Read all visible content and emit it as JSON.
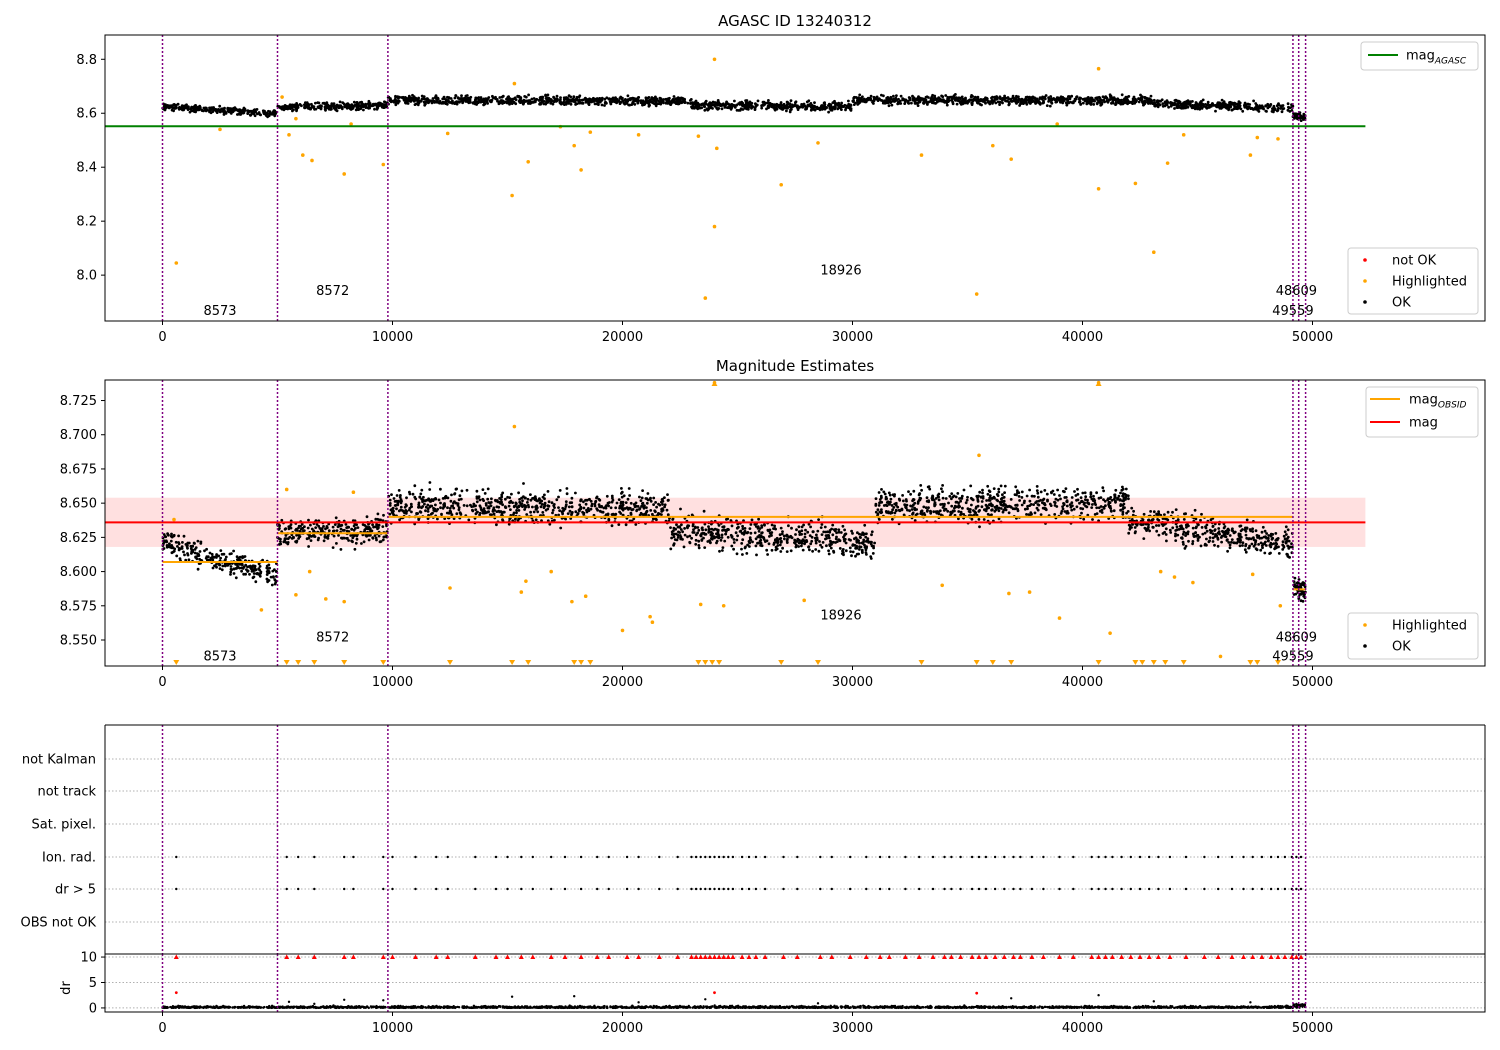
{
  "chart_data": [
    {
      "id": "top",
      "type": "scatter",
      "title": "AGASC ID 13240312",
      "xlim": [
        -2500,
        57500
      ],
      "ylim": [
        7.83,
        8.89
      ],
      "xticks": [
        0,
        10000,
        20000,
        30000,
        40000,
        50000
      ],
      "yticks": [
        8.0,
        8.2,
        8.4,
        8.6,
        8.8
      ],
      "ytick_labels": [
        "8.0",
        "8.2",
        "8.4",
        "8.6",
        "8.8"
      ],
      "legend_lines": [
        {
          "label": "mag",
          "sub": "AGASC",
          "color": "#008000"
        }
      ],
      "legend_points": [
        {
          "label": "not OK",
          "color": "#ff0000"
        },
        {
          "label": "Highlighted",
          "color": "#ffa500"
        },
        {
          "label": "OK",
          "color": "#000000"
        }
      ],
      "hline": {
        "y": 8.552,
        "x0": -2500,
        "x1": 52300,
        "color": "#008000"
      },
      "obsid_boundaries": [
        0,
        5000,
        9800,
        49150,
        49400,
        49700
      ],
      "obsid_labels": [
        {
          "text": "8573",
          "x": 2500,
          "y": 7.87
        },
        {
          "text": "8572",
          "x": 7400,
          "y": 7.945
        },
        {
          "text": "18926",
          "x": 29500,
          "y": 8.02
        },
        {
          "text": "48609",
          "x": 49300,
          "y": 7.945
        },
        {
          "text": "49559",
          "x": 49150,
          "y": 7.87
        }
      ],
      "ok_segments": [
        {
          "x0": 0,
          "x1": 5000,
          "y0": 8.625,
          "y1": 8.598,
          "spread": 0.018
        },
        {
          "x0": 5000,
          "x1": 9800,
          "y0": 8.622,
          "y1": 8.63,
          "spread": 0.02
        },
        {
          "x0": 9800,
          "x1": 23000,
          "y0": 8.648,
          "y1": 8.645,
          "spread": 0.025
        },
        {
          "x0": 23000,
          "x1": 30000,
          "y0": 8.63,
          "y1": 8.625,
          "spread": 0.025
        },
        {
          "x0": 30000,
          "x1": 43000,
          "y0": 8.648,
          "y1": 8.648,
          "spread": 0.025
        },
        {
          "x0": 43000,
          "x1": 49150,
          "y0": 8.635,
          "y1": 8.62,
          "spread": 0.025
        },
        {
          "x0": 49150,
          "x1": 49700,
          "y0": 8.59,
          "y1": 8.585,
          "spread": 0.02
        }
      ],
      "highlighted_points": [
        [
          600,
          8.045
        ],
        [
          2500,
          8.54
        ],
        [
          5200,
          8.66
        ],
        [
          5500,
          8.52
        ],
        [
          5800,
          8.58
        ],
        [
          6100,
          8.445
        ],
        [
          6500,
          8.425
        ],
        [
          7900,
          8.375
        ],
        [
          8200,
          8.56
        ],
        [
          9600,
          8.41
        ],
        [
          12400,
          8.525
        ],
        [
          15200,
          8.295
        ],
        [
          15300,
          8.71
        ],
        [
          15900,
          8.42
        ],
        [
          17300,
          8.55
        ],
        [
          17900,
          8.48
        ],
        [
          18200,
          8.39
        ],
        [
          18600,
          8.53
        ],
        [
          20700,
          8.52
        ],
        [
          23300,
          8.515
        ],
        [
          23600,
          7.915
        ],
        [
          24000,
          8.8
        ],
        [
          24100,
          8.47
        ],
        [
          24000,
          8.18
        ],
        [
          26900,
          8.335
        ],
        [
          28500,
          8.49
        ],
        [
          33000,
          8.445
        ],
        [
          35400,
          7.93
        ],
        [
          36100,
          8.48
        ],
        [
          36900,
          8.43
        ],
        [
          38900,
          8.56
        ],
        [
          40700,
          8.765
        ],
        [
          40700,
          8.32
        ],
        [
          42300,
          8.34
        ],
        [
          43100,
          8.085
        ],
        [
          43700,
          8.415
        ],
        [
          44400,
          8.52
        ],
        [
          47300,
          8.445
        ],
        [
          47600,
          8.51
        ],
        [
          48500,
          8.505
        ]
      ],
      "ok_color": "#000000",
      "highlight_color": "#ffa500",
      "notok_color": "#ff0000"
    },
    {
      "id": "mid",
      "type": "scatter",
      "title": "Magnitude Estimates",
      "xlim": [
        -2500,
        57500
      ],
      "ylim": [
        8.531,
        8.74
      ],
      "xticks": [
        0,
        10000,
        20000,
        30000,
        40000,
        50000
      ],
      "yticks": [
        8.55,
        8.575,
        8.6,
        8.625,
        8.65,
        8.675,
        8.7,
        8.725
      ],
      "ytick_labels": [
        "8.550",
        "8.575",
        "8.600",
        "8.625",
        "8.650",
        "8.675",
        "8.700",
        "8.725"
      ],
      "legend_lines": [
        {
          "label": "mag",
          "sub": "OBSID",
          "color": "#ffa500"
        },
        {
          "label": "mag",
          "sub": "",
          "color": "#ff0000"
        }
      ],
      "legend_points": [
        {
          "label": "Highlighted",
          "color": "#ffa500"
        },
        {
          "label": "OK",
          "color": "#000000"
        }
      ],
      "mag_line": {
        "y": 8.636,
        "x0": -2500,
        "x1": 52300,
        "color": "#ff0000",
        "band": [
          8.618,
          8.654
        ]
      },
      "obsid_mags": [
        {
          "x0": 0,
          "x1": 5000,
          "y": 8.607
        },
        {
          "x0": 5000,
          "x1": 9800,
          "y": 8.628
        },
        {
          "x0": 9800,
          "x1": 49150,
          "y": 8.64
        },
        {
          "x0": 49150,
          "x1": 49700,
          "y": 8.587
        }
      ],
      "obsid_boundaries": [
        0,
        5000,
        9800,
        49150,
        49400,
        49700
      ],
      "obsid_labels": [
        {
          "text": "8573",
          "x": 2500,
          "y": 8.5385
        },
        {
          "text": "8572",
          "x": 7400,
          "y": 8.5525
        },
        {
          "text": "18926",
          "x": 29500,
          "y": 8.5685
        },
        {
          "text": "48609",
          "x": 49300,
          "y": 8.5525
        },
        {
          "text": "49559",
          "x": 49150,
          "y": 8.5385
        }
      ],
      "ok_segments": [
        {
          "x0": 0,
          "x1": 1500,
          "y0": 8.622,
          "y1": 8.615,
          "spread": 0.012
        },
        {
          "x0": 1500,
          "x1": 5000,
          "y0": 8.612,
          "y1": 8.598,
          "spread": 0.012
        },
        {
          "x0": 5000,
          "x1": 9800,
          "y0": 8.628,
          "y1": 8.63,
          "spread": 0.014
        },
        {
          "x0": 9800,
          "x1": 22000,
          "y0": 8.648,
          "y1": 8.646,
          "spread": 0.018
        },
        {
          "x0": 22000,
          "x1": 31000,
          "y0": 8.63,
          "y1": 8.622,
          "spread": 0.018
        },
        {
          "x0": 31000,
          "x1": 42000,
          "y0": 8.648,
          "y1": 8.65,
          "spread": 0.018
        },
        {
          "x0": 42000,
          "x1": 49150,
          "y0": 8.638,
          "y1": 8.62,
          "spread": 0.016
        },
        {
          "x0": 49150,
          "x1": 49700,
          "y0": 8.59,
          "y1": 8.585,
          "spread": 0.01
        }
      ],
      "highlighted_points": [
        [
          500,
          8.638
        ],
        [
          4300,
          8.572
        ],
        [
          5400,
          8.66
        ],
        [
          5800,
          8.583
        ],
        [
          6400,
          8.6
        ],
        [
          7100,
          8.58
        ],
        [
          7900,
          8.578
        ],
        [
          8300,
          8.658
        ],
        [
          12500,
          8.588
        ],
        [
          15300,
          8.706
        ],
        [
          15600,
          8.585
        ],
        [
          15800,
          8.593
        ],
        [
          16900,
          8.6
        ],
        [
          17800,
          8.578
        ],
        [
          18400,
          8.582
        ],
        [
          20000,
          8.557
        ],
        [
          21200,
          8.567
        ],
        [
          21300,
          8.563
        ],
        [
          23400,
          8.576
        ],
        [
          24000,
          8.738
        ],
        [
          24400,
          8.575
        ],
        [
          27900,
          8.579
        ],
        [
          33900,
          8.59
        ],
        [
          35500,
          8.685
        ],
        [
          36800,
          8.584
        ],
        [
          37700,
          8.585
        ],
        [
          39000,
          8.566
        ],
        [
          40700,
          8.738
        ],
        [
          41200,
          8.555
        ],
        [
          43400,
          8.6
        ],
        [
          44000,
          8.596
        ],
        [
          44800,
          8.592
        ],
        [
          46000,
          8.538
        ],
        [
          47400,
          8.598
        ],
        [
          48600,
          8.575
        ]
      ],
      "clipped_x": [
        600,
        5400,
        5900,
        6600,
        7900,
        9600,
        12500,
        15200,
        15900,
        17900,
        18200,
        18600,
        23300,
        23600,
        23900,
        24200,
        26900,
        28500,
        33000,
        35400,
        36100,
        36900,
        40700,
        42300,
        42600,
        43100,
        43600,
        44400,
        47300,
        47600,
        48500
      ],
      "ok_color": "#000000",
      "highlight_color": "#ffa500"
    },
    {
      "id": "flags",
      "type": "scatter",
      "xlim": [
        -2500,
        57500
      ],
      "categories": [
        "OBS not OK",
        "dr > 5",
        "Ion. rad.",
        "Sat. pixel.",
        "not track",
        "not Kalman"
      ],
      "flag_rows": {
        "dr > 5": true,
        "Ion. rad.": true
      },
      "flag_x": [
        600,
        5400,
        5900,
        6600,
        7900,
        8300,
        9600,
        10000,
        11000,
        11900,
        12400,
        13600,
        14500,
        15000,
        15600,
        16100,
        16900,
        17500,
        18200,
        18900,
        19400,
        20200,
        20700,
        21600,
        22400,
        23000,
        23200,
        23400,
        23600,
        23800,
        24000,
        24200,
        24400,
        24600,
        24800,
        25200,
        25500,
        25800,
        26200,
        27000,
        27600,
        28600,
        29100,
        29900,
        30600,
        31200,
        31600,
        32300,
        32900,
        33500,
        34000,
        34300,
        34700,
        35200,
        35500,
        35800,
        36200,
        36600,
        37000,
        37300,
        37800,
        38300,
        39000,
        39600,
        40400,
        40700,
        41000,
        41300,
        41700,
        42100,
        42500,
        42900,
        43300,
        43800,
        44500,
        45300,
        45900,
        46500,
        47000,
        47400,
        47800,
        48200,
        48500,
        48800,
        49100,
        49300,
        49500
      ],
      "obsid_boundaries": [
        0,
        5000,
        9800,
        49150,
        49400,
        49700
      ]
    },
    {
      "id": "dr",
      "type": "scatter",
      "ylabel": "dr",
      "xlim": [
        -2500,
        57500
      ],
      "ylim": [
        -0.8,
        10.6
      ],
      "xticks": [
        0,
        10000,
        20000,
        30000,
        40000,
        50000
      ],
      "yticks": [
        0,
        5,
        10
      ],
      "ytick_labels": [
        "0",
        "5",
        "10"
      ],
      "capped_x": [
        600,
        5400,
        5900,
        6600,
        7900,
        8300,
        9600,
        10000,
        11000,
        11900,
        12400,
        13600,
        14500,
        15000,
        15600,
        16100,
        16900,
        17500,
        18200,
        18900,
        19400,
        20200,
        20700,
        21600,
        22400,
        23000,
        23200,
        23400,
        23600,
        23800,
        24000,
        24200,
        24400,
        24600,
        24800,
        25200,
        25500,
        25800,
        26200,
        27000,
        27600,
        28600,
        29100,
        29900,
        30600,
        31200,
        31600,
        32300,
        32900,
        33500,
        34000,
        34300,
        34700,
        35200,
        35500,
        35800,
        36200,
        36600,
        37000,
        37300,
        37800,
        38300,
        39000,
        39600,
        40400,
        40700,
        41000,
        41300,
        41700,
        42100,
        42500,
        42900,
        43300,
        43800,
        44500,
        45300,
        45900,
        46500,
        47000,
        47400,
        47800,
        48200,
        48500,
        48800,
        49100,
        49300,
        49500
      ],
      "red_points": [
        [
          600,
          3.0
        ],
        [
          24000,
          3.0
        ],
        [
          35400,
          2.9
        ]
      ],
      "black_points": [
        [
          5500,
          1.2
        ],
        [
          6600,
          0.8
        ],
        [
          7900,
          1.6
        ],
        [
          9600,
          1.5
        ],
        [
          15200,
          2.2
        ],
        [
          17900,
          2.3
        ],
        [
          20700,
          1.1
        ],
        [
          23600,
          1.7
        ],
        [
          28500,
          0.9
        ],
        [
          36900,
          1.9
        ],
        [
          40700,
          2.5
        ],
        [
          43100,
          1.3
        ],
        [
          47300,
          1.1
        ]
      ],
      "obsid_boundaries": [
        0,
        5000,
        9800,
        49150,
        49400,
        49700
      ]
    }
  ]
}
